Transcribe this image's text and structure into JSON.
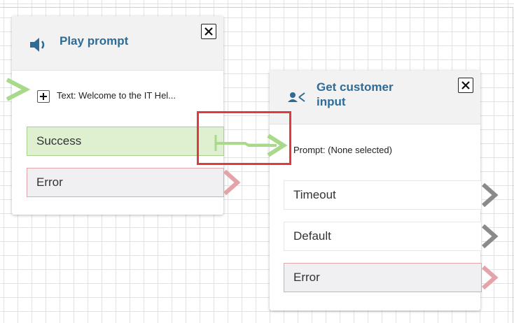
{
  "play_prompt": {
    "title": "Play prompt",
    "icon": "speaker-icon",
    "prompt_text": "Text: Welcome to the IT Hel...",
    "branches": {
      "success": "Success",
      "error": "Error"
    }
  },
  "get_input": {
    "title_line1": "Get customer",
    "title_line2": "input",
    "icon": "user-branch-icon",
    "prompt_text": "Prompt: (None selected)",
    "branches": {
      "timeout": "Timeout",
      "default": "Default",
      "error": "Error"
    }
  },
  "colors": {
    "title": "#2f6b94",
    "success_fill": "#dff0d0",
    "connector_green": "#a9d98a",
    "error_border": "#e0a6ac",
    "highlight_red": "#e0393e"
  }
}
